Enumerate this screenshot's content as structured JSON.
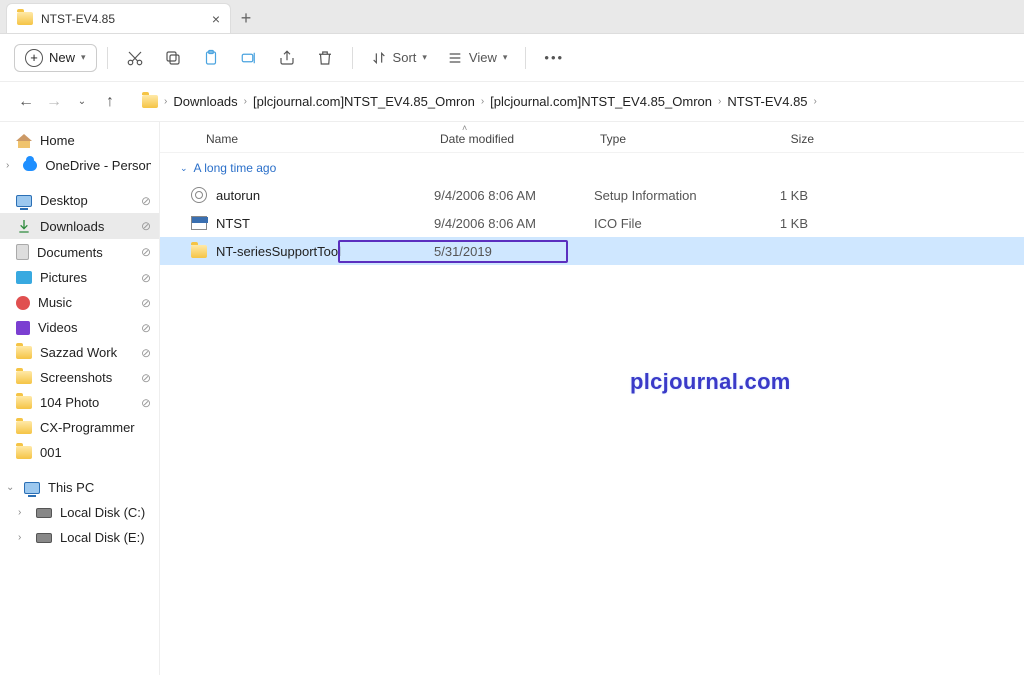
{
  "tab": {
    "title": "NTST-EV4.85"
  },
  "toolbar": {
    "new_label": "New",
    "sort_label": "Sort",
    "view_label": "View"
  },
  "breadcrumbs": {
    "b0": "Downloads",
    "b1": "[plcjournal.com]NTST_EV4.85_Omron",
    "b2": "[plcjournal.com]NTST_EV4.85_Omron",
    "b3": "NTST-EV4.85"
  },
  "sidebar": {
    "home": "Home",
    "onedrive": "OneDrive - Personal",
    "desktop": "Desktop",
    "downloads": "Downloads",
    "documents": "Documents",
    "pictures": "Pictures",
    "music": "Music",
    "videos": "Videos",
    "sazzad": "Sazzad Work",
    "screenshots": "Screenshots",
    "photo104": "104 Photo",
    "cxprog": "CX-Programmer",
    "f001": "001",
    "thispc": "This PC",
    "diskc": "Local Disk (C:)",
    "diske": "Local Disk (E:)"
  },
  "columns": {
    "name": "Name",
    "date": "Date modified",
    "type": "Type",
    "size": "Size"
  },
  "group": {
    "label": "A long time ago"
  },
  "files": {
    "r0": {
      "name": "autorun",
      "date": "9/4/2006 8:06 AM",
      "type": "Setup Information",
      "size": "1 KB"
    },
    "r1": {
      "name": "NTST",
      "date": "9/4/2006 8:06 AM",
      "type": "ICO File",
      "size": "1 KB"
    },
    "r2": {
      "name": "NT-seriesSupportTool",
      "date": "5/31/2019",
      "type": "",
      "size": ""
    }
  },
  "watermark": "plcjournal.com"
}
